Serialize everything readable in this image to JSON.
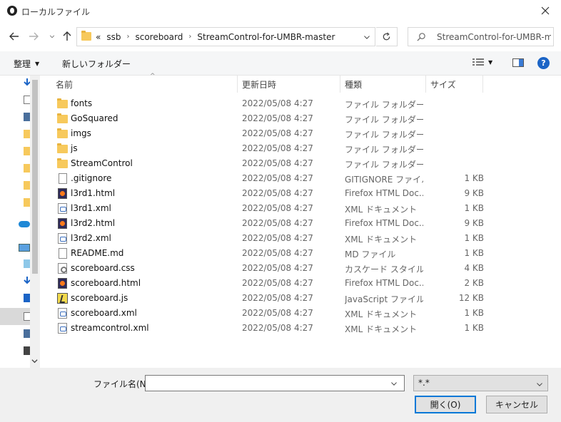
{
  "window": {
    "title": "ローカルファイル"
  },
  "nav": {
    "breadcrumb_prefix": "«",
    "breadcrumbs": [
      "ssb",
      "scoreboard",
      "StreamControl-for-UMBR-master"
    ],
    "search_placeholder": "StreamControl-for-UMBR-m..."
  },
  "toolbar": {
    "organize": "整理",
    "new_folder": "新しいフォルダー"
  },
  "columns": {
    "name": "名前",
    "date": "更新日時",
    "type": "種類",
    "size": "サイズ"
  },
  "files": [
    {
      "icon": "folder",
      "name": "fonts",
      "date": "2022/05/08 4:27",
      "type": "ファイル フォルダー",
      "size": ""
    },
    {
      "icon": "folder",
      "name": "GoSquared",
      "date": "2022/05/08 4:27",
      "type": "ファイル フォルダー",
      "size": ""
    },
    {
      "icon": "folder",
      "name": "imgs",
      "date": "2022/05/08 4:27",
      "type": "ファイル フォルダー",
      "size": ""
    },
    {
      "icon": "folder",
      "name": "js",
      "date": "2022/05/08 4:27",
      "type": "ファイル フォルダー",
      "size": ""
    },
    {
      "icon": "folder",
      "name": "StreamControl",
      "date": "2022/05/08 4:27",
      "type": "ファイル フォルダー",
      "size": ""
    },
    {
      "icon": "doc",
      "name": ".gitignore",
      "date": "2022/05/08 4:27",
      "type": "GITIGNORE ファイル",
      "size": "1 KB"
    },
    {
      "icon": "html",
      "name": "l3rd1.html",
      "date": "2022/05/08 4:27",
      "type": "Firefox HTML Doc...",
      "size": "9 KB"
    },
    {
      "icon": "xml",
      "name": "l3rd1.xml",
      "date": "2022/05/08 4:27",
      "type": "XML ドキュメント",
      "size": "1 KB"
    },
    {
      "icon": "html",
      "name": "l3rd2.html",
      "date": "2022/05/08 4:27",
      "type": "Firefox HTML Doc...",
      "size": "9 KB"
    },
    {
      "icon": "xml",
      "name": "l3rd2.xml",
      "date": "2022/05/08 4:27",
      "type": "XML ドキュメント",
      "size": "1 KB"
    },
    {
      "icon": "doc",
      "name": "README.md",
      "date": "2022/05/08 4:27",
      "type": "MD ファイル",
      "size": "1 KB"
    },
    {
      "icon": "css",
      "name": "scoreboard.css",
      "date": "2022/05/08 4:27",
      "type": "カスケード スタイル シ...",
      "size": "4 KB"
    },
    {
      "icon": "html",
      "name": "scoreboard.html",
      "date": "2022/05/08 4:27",
      "type": "Firefox HTML Doc...",
      "size": "2 KB"
    },
    {
      "icon": "js",
      "name": "scoreboard.js",
      "date": "2022/05/08 4:27",
      "type": "JavaScript ファイル",
      "size": "12 KB"
    },
    {
      "icon": "xml",
      "name": "scoreboard.xml",
      "date": "2022/05/08 4:27",
      "type": "XML ドキュメント",
      "size": "1 KB"
    },
    {
      "icon": "xml",
      "name": "streamcontrol.xml",
      "date": "2022/05/08 4:27",
      "type": "XML ドキュメント",
      "size": "1 KB"
    }
  ],
  "bottom": {
    "filename_label": "ファイル名(N):",
    "filename_value": "",
    "filter_value": "*.*",
    "open_button": "開く(O)",
    "cancel_button": "キャンセル"
  },
  "colors": {
    "accent": "#0078d7",
    "folder": "#f7c95c",
    "help": "#1b64c6"
  }
}
